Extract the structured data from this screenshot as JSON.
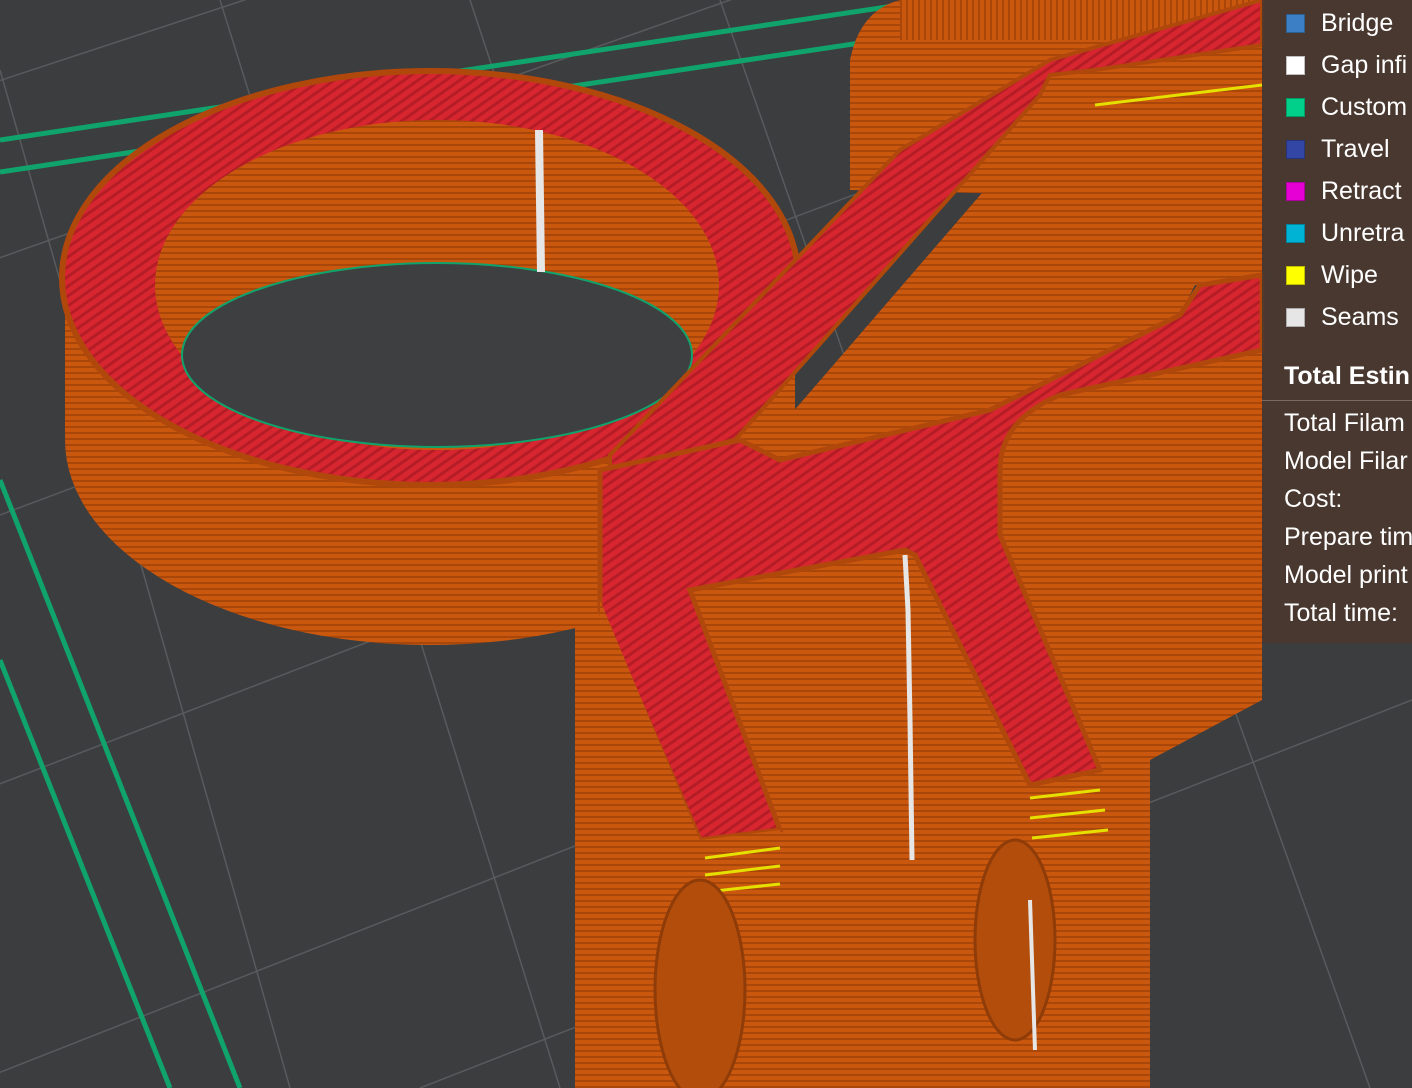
{
  "legend": {
    "items": [
      {
        "label": "Bridge",
        "color": "#3d7fc4"
      },
      {
        "label": "Gap infi",
        "color": "#ffffff"
      },
      {
        "label": "Custom",
        "color": "#00d08a"
      },
      {
        "label": "Travel",
        "color": "#3346a6"
      },
      {
        "label": "Retract",
        "color": "#e600d6"
      },
      {
        "label": "Unretra",
        "color": "#00b2d4"
      },
      {
        "label": "Wipe",
        "color": "#ffff00"
      },
      {
        "label": "Seams",
        "color": "#e6e6e6"
      }
    ]
  },
  "summary": {
    "title": "Total Estin",
    "rows": [
      "Total Filam",
      "Model Filar",
      "Cost:",
      "Prepare tim",
      "Model print",
      "Total time:"
    ]
  },
  "colors": {
    "bed": "#3b3d3f",
    "grid": "#55585a",
    "wall": "#c85a0e",
    "top_surface": "#d8262e",
    "border": "#0fa26c",
    "wipe": "#e5e000",
    "seam": "#e6e6e6"
  }
}
